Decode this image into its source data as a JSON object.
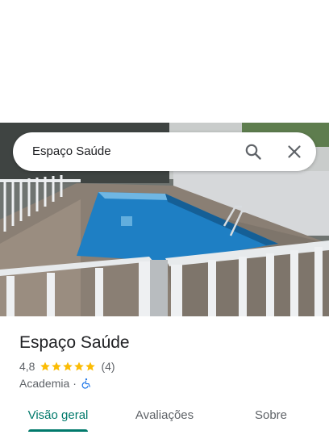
{
  "search": {
    "query": "Espaço Saúde",
    "search_icon": "search-icon",
    "close_icon": "close-icon"
  },
  "place": {
    "name": "Espaço Saúde",
    "rating": "4,8",
    "stars_filled": 5,
    "review_count": "(4)",
    "category": "Academia",
    "separator": "·",
    "accessibility_icon": "wheelchair-icon"
  },
  "tabs": [
    {
      "label": "Visão geral",
      "active": true
    },
    {
      "label": "Avaliações",
      "active": false
    },
    {
      "label": "Sobre",
      "active": false
    }
  ],
  "colors": {
    "accent": "#00796b",
    "star": "#fbbc04",
    "accessibility": "#1a73e8",
    "text_secondary": "#5f6368"
  }
}
